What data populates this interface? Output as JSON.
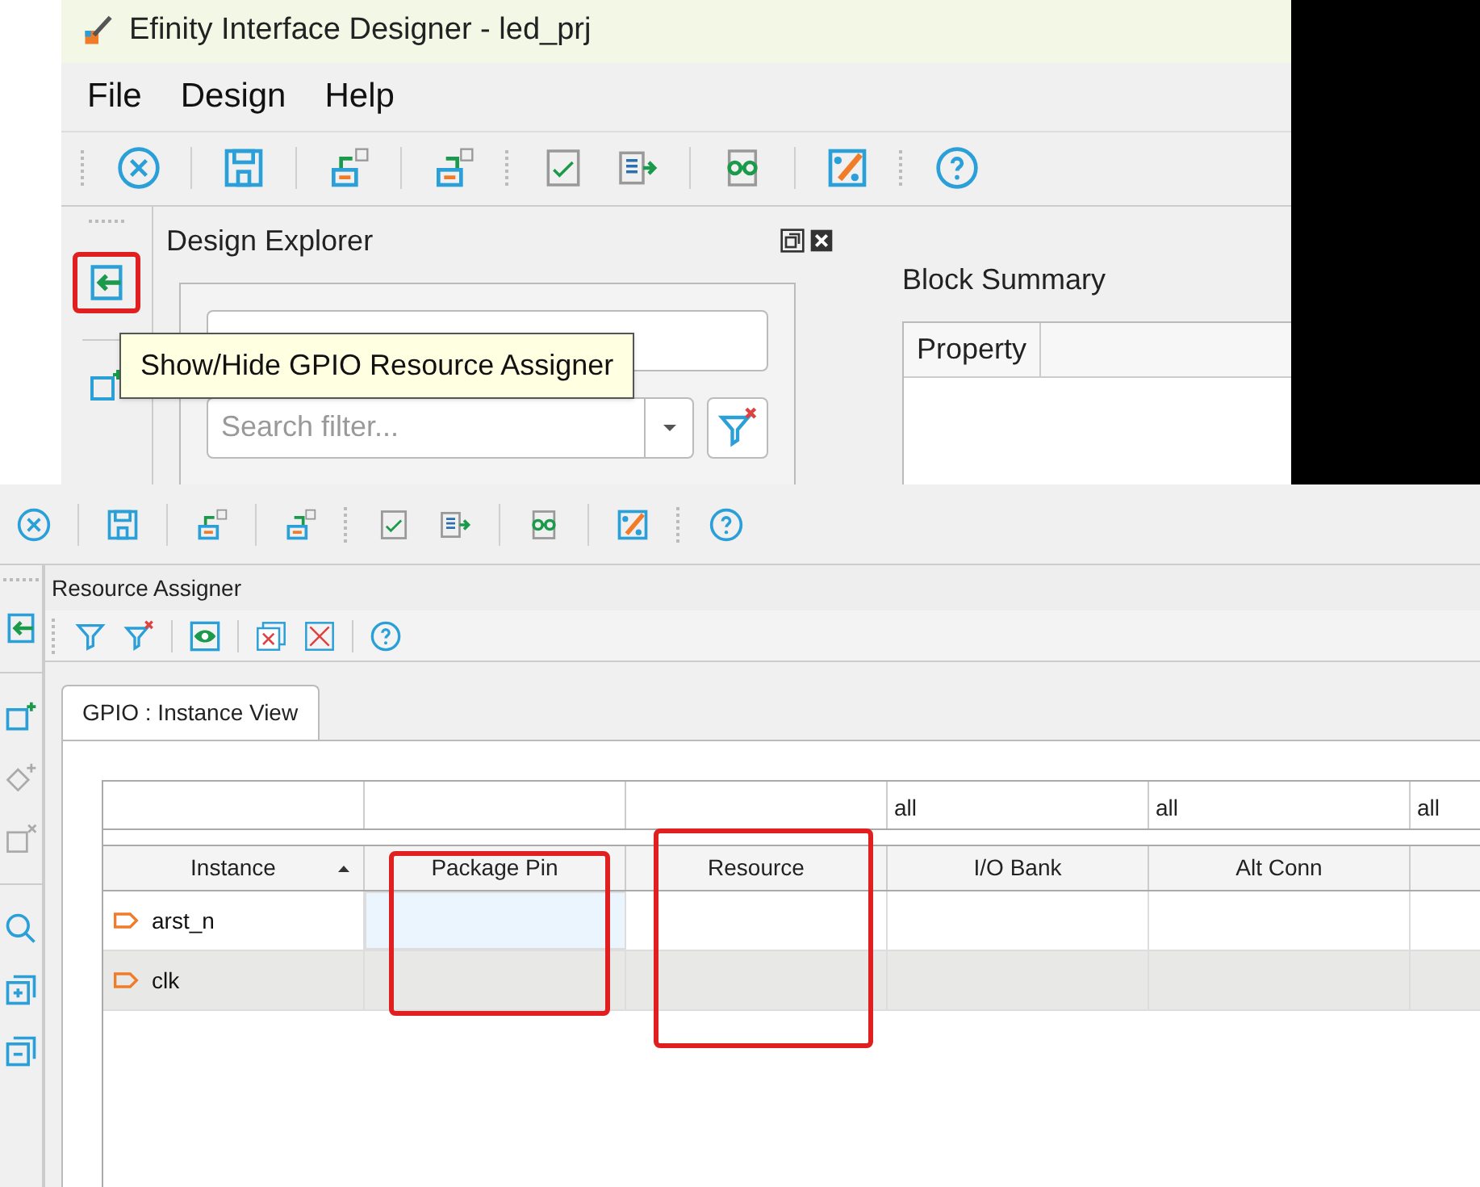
{
  "top_window": {
    "title": "Efinity Interface Designer - led_prj",
    "menu": [
      "File",
      "Design",
      "Help"
    ],
    "design_explorer": {
      "title": "Design Explorer",
      "search_placeholder": "Search filter..."
    },
    "block_summary": {
      "title": "Block Summary",
      "columns": [
        "Property"
      ]
    },
    "tooltip": "Show/Hide GPIO Resource Assigner"
  },
  "bottom_window": {
    "panel_title": "Resource Assigner",
    "tabs": [
      {
        "label": "GPIO : Instance View",
        "selected": true
      }
    ],
    "table": {
      "filters": [
        "all",
        "all",
        "all"
      ],
      "columns": [
        {
          "label": "Instance",
          "sorted": true
        },
        {
          "label": "Package Pin",
          "sorted": false
        },
        {
          "label": "Resource",
          "sorted": false
        },
        {
          "label": "I/O Bank",
          "sorted": false
        },
        {
          "label": "Alt Conn",
          "sorted": false
        }
      ],
      "rows": [
        {
          "instance": "arst_n",
          "package_pin_focused": true
        },
        {
          "instance": "clk",
          "package_pin_focused": false
        }
      ]
    }
  }
}
